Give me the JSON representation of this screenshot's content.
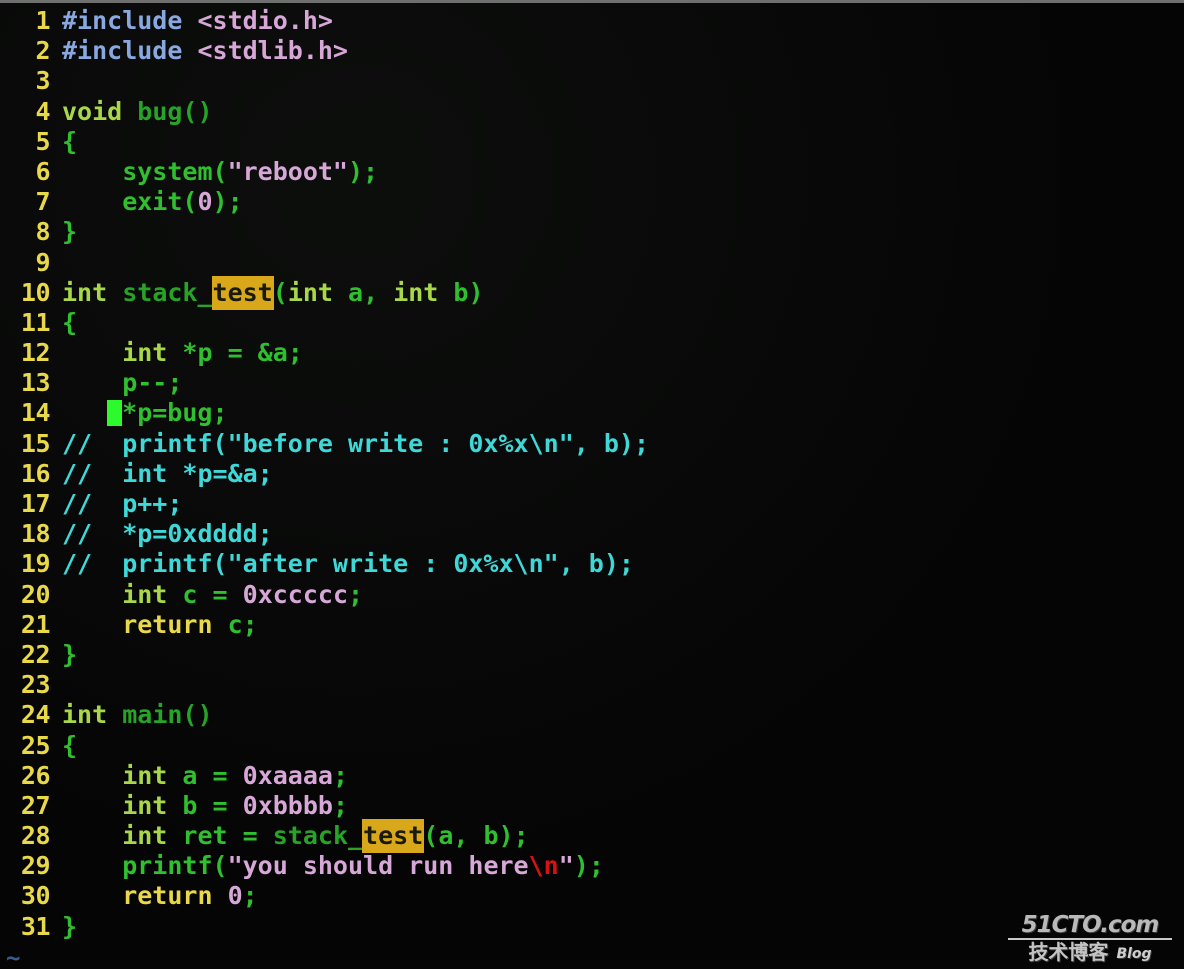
{
  "window": {
    "kind": "terminal-code-editor",
    "background_color": "#050505",
    "top_border_color": "#6f6f6f"
  },
  "gutter": {
    "line_number_color": "#e8d84a"
  },
  "search": {
    "match_term": "test",
    "highlight_bg": "#d8a81a",
    "highlight_fg": "#1a1a0a"
  },
  "cursor": {
    "line": 14,
    "column": 5,
    "color": "#2dfa2d",
    "shape": "block"
  },
  "palette": {
    "preprocessor": "#8aa8e0",
    "header": "#d7a8d7",
    "type_keyword": "#a8d84a",
    "control_keyword": "#e8d84a",
    "identifier": "#2fbf2f",
    "function": "#27a327",
    "number": "#d7a8d7",
    "string": "#d7a8d7",
    "escape": "#d81212",
    "comment": "#3fd8d8"
  },
  "empty_marker": "~",
  "watermark": {
    "top": "51CTO.com",
    "bottom_cn": "技术博客",
    "bottom_en": "Blog"
  },
  "lines": [
    {
      "n": "1",
      "tokens": [
        {
          "t": "#include ",
          "c": "pre"
        },
        {
          "t": "<stdio.h>",
          "c": "header"
        }
      ]
    },
    {
      "n": "2",
      "tokens": [
        {
          "t": "#include ",
          "c": "pre"
        },
        {
          "t": "<stdlib.h>",
          "c": "header"
        }
      ]
    },
    {
      "n": "3",
      "tokens": []
    },
    {
      "n": "4",
      "tokens": [
        {
          "t": "void ",
          "c": "type"
        },
        {
          "t": "bug()",
          "c": "func"
        }
      ]
    },
    {
      "n": "5",
      "tokens": [
        {
          "t": "{",
          "c": "ident"
        }
      ]
    },
    {
      "n": "6",
      "tokens": [
        {
          "t": "    system(",
          "c": "ident"
        },
        {
          "t": "\"reboot\"",
          "c": "str"
        },
        {
          "t": ");",
          "c": "ident"
        }
      ]
    },
    {
      "n": "7",
      "tokens": [
        {
          "t": "    exit(",
          "c": "ident"
        },
        {
          "t": "0",
          "c": "num"
        },
        {
          "t": ");",
          "c": "ident"
        }
      ]
    },
    {
      "n": "8",
      "tokens": [
        {
          "t": "}",
          "c": "ident"
        }
      ]
    },
    {
      "n": "9",
      "tokens": []
    },
    {
      "n": "10",
      "tokens": [
        {
          "t": "int ",
          "c": "type"
        },
        {
          "t": "stack_",
          "c": "func"
        },
        {
          "t": "test",
          "c": "hit"
        },
        {
          "t": "(",
          "c": "ident"
        },
        {
          "t": "int ",
          "c": "type"
        },
        {
          "t": "a",
          "c": "ident"
        },
        {
          "t": ", ",
          "c": "ident"
        },
        {
          "t": "int ",
          "c": "type"
        },
        {
          "t": "b)",
          "c": "ident"
        }
      ]
    },
    {
      "n": "11",
      "tokens": [
        {
          "t": "{",
          "c": "ident"
        }
      ]
    },
    {
      "n": "12",
      "tokens": [
        {
          "t": "    int ",
          "c": "type"
        },
        {
          "t": "*p = &a;",
          "c": "ident"
        }
      ]
    },
    {
      "n": "13",
      "tokens": [
        {
          "t": "    p--;",
          "c": "ident"
        }
      ]
    },
    {
      "n": "14",
      "tokens": [
        {
          "t": "   ",
          "c": "ident"
        },
        {
          "t": "",
          "c": "cursor"
        },
        {
          "t": "*p=bug;",
          "c": "ident"
        }
      ]
    },
    {
      "n": "15",
      "tokens": [
        {
          "t": "//  printf(\"before write : 0x%x\\n\", b);",
          "c": "comment"
        }
      ]
    },
    {
      "n": "16",
      "tokens": [
        {
          "t": "//  int *p=&a;",
          "c": "comment"
        }
      ]
    },
    {
      "n": "17",
      "tokens": [
        {
          "t": "//  p++;",
          "c": "comment"
        }
      ]
    },
    {
      "n": "18",
      "tokens": [
        {
          "t": "//  *p=0xdddd;",
          "c": "comment"
        }
      ]
    },
    {
      "n": "19",
      "tokens": [
        {
          "t": "//  printf(\"after write : 0x%x\\n\", b);",
          "c": "comment"
        }
      ]
    },
    {
      "n": "20",
      "tokens": [
        {
          "t": "    int ",
          "c": "type"
        },
        {
          "t": "c = ",
          "c": "ident"
        },
        {
          "t": "0xccccc",
          "c": "num"
        },
        {
          "t": ";",
          "c": "ident"
        }
      ]
    },
    {
      "n": "21",
      "tokens": [
        {
          "t": "    return ",
          "c": "kw"
        },
        {
          "t": "c;",
          "c": "ident"
        }
      ]
    },
    {
      "n": "22",
      "tokens": [
        {
          "t": "}",
          "c": "ident"
        }
      ]
    },
    {
      "n": "23",
      "tokens": []
    },
    {
      "n": "24",
      "tokens": [
        {
          "t": "int ",
          "c": "type"
        },
        {
          "t": "main()",
          "c": "func"
        }
      ]
    },
    {
      "n": "25",
      "tokens": [
        {
          "t": "{",
          "c": "ident"
        }
      ]
    },
    {
      "n": "26",
      "tokens": [
        {
          "t": "    int ",
          "c": "type"
        },
        {
          "t": "a = ",
          "c": "ident"
        },
        {
          "t": "0xaaaa",
          "c": "num"
        },
        {
          "t": ";",
          "c": "ident"
        }
      ]
    },
    {
      "n": "27",
      "tokens": [
        {
          "t": "    int ",
          "c": "type"
        },
        {
          "t": "b = ",
          "c": "ident"
        },
        {
          "t": "0xbbbb",
          "c": "num"
        },
        {
          "t": ";",
          "c": "ident"
        }
      ]
    },
    {
      "n": "28",
      "tokens": [
        {
          "t": "    int ",
          "c": "type"
        },
        {
          "t": "ret = ",
          "c": "ident"
        },
        {
          "t": "stack_",
          "c": "func"
        },
        {
          "t": "test",
          "c": "hit"
        },
        {
          "t": "(a, b);",
          "c": "ident"
        }
      ]
    },
    {
      "n": "29",
      "tokens": [
        {
          "t": "    printf(",
          "c": "ident"
        },
        {
          "t": "\"you should run here",
          "c": "str"
        },
        {
          "t": "\\n",
          "c": "esc"
        },
        {
          "t": "\"",
          "c": "str"
        },
        {
          "t": ");",
          "c": "ident"
        }
      ]
    },
    {
      "n": "30",
      "tokens": [
        {
          "t": "    return ",
          "c": "kw"
        },
        {
          "t": "0",
          "c": "num"
        },
        {
          "t": ";",
          "c": "ident"
        }
      ]
    },
    {
      "n": "31",
      "tokens": [
        {
          "t": "}",
          "c": "ident"
        }
      ]
    }
  ]
}
